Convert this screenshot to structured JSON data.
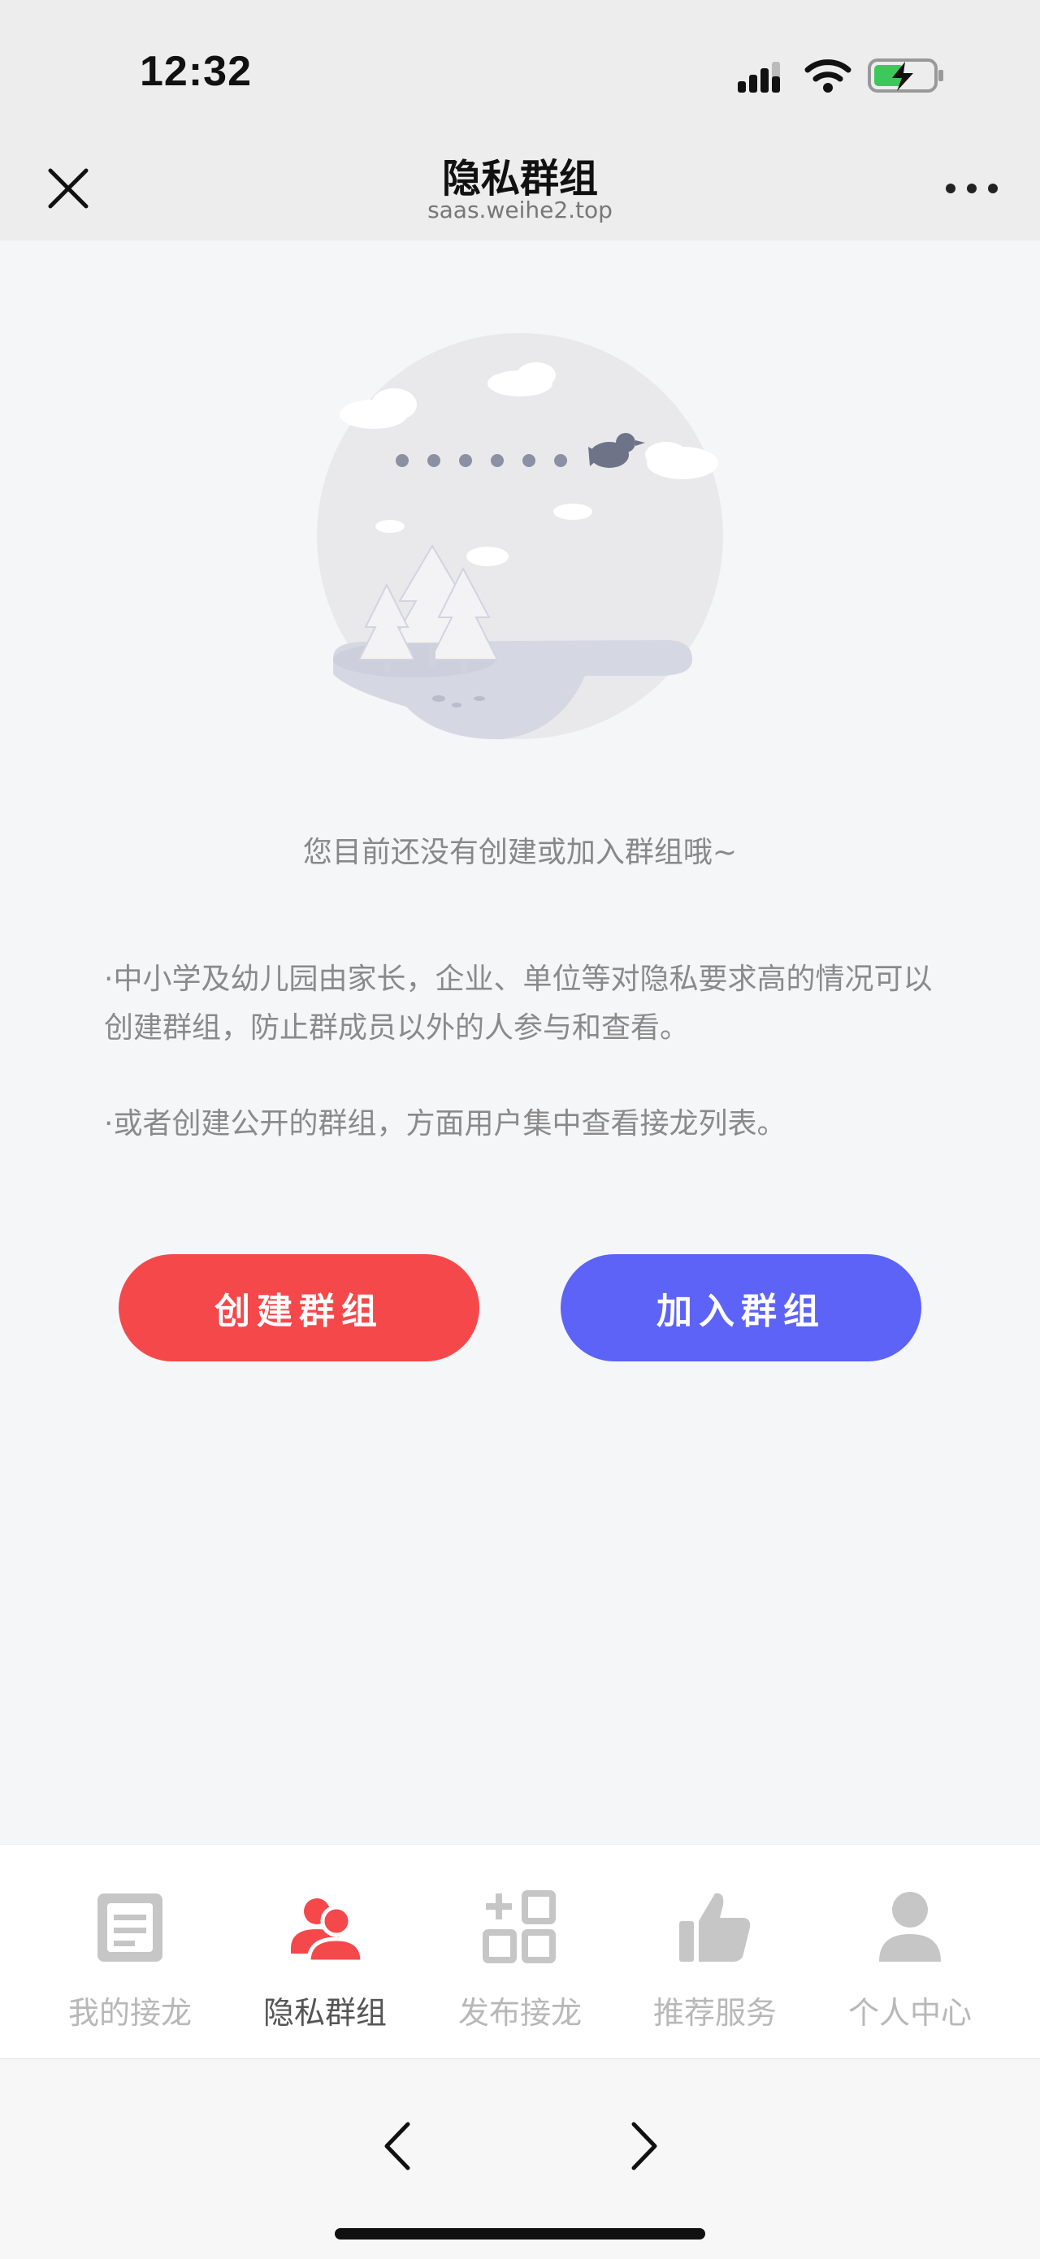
{
  "status": {
    "time": "12:32"
  },
  "nav": {
    "title": "隐私群组",
    "subtitle": "saas.weihe2.top"
  },
  "empty": {
    "message": "您目前还没有创建或加入群组哦~"
  },
  "descriptions": [
    "·中小学及幼儿园由家长，企业、单位等对隐私要求高的情况可以创建群组，防止群成员以外的人参与和查看。",
    "·或者创建公开的群组，方面用户集中查看接龙列表。"
  ],
  "buttons": {
    "create": "创建群组",
    "join": "加入群组"
  },
  "tabs": [
    {
      "label": "我的接龙",
      "icon": "document-icon",
      "active": false
    },
    {
      "label": "隐私群组",
      "icon": "group-icon",
      "active": true
    },
    {
      "label": "发布接龙",
      "icon": "add-grid-icon",
      "active": false
    },
    {
      "label": "推荐服务",
      "icon": "thumbs-up-icon",
      "active": false
    },
    {
      "label": "个人中心",
      "icon": "person-icon",
      "active": false
    }
  ],
  "colors": {
    "create_button": "#f5484a",
    "join_button": "#5c63f6",
    "active_tab_icon": "#f5484a",
    "inactive_tab": "#b8b8b8"
  }
}
